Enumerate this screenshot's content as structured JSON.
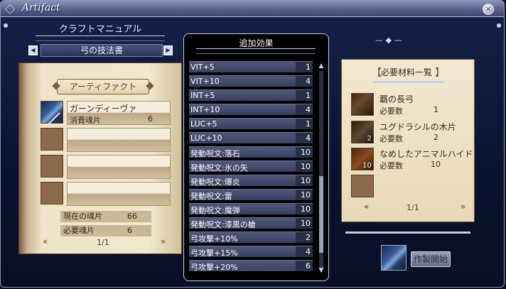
{
  "window": {
    "title": "Artifact",
    "close_symbol": "×"
  },
  "left": {
    "header": "クラフトマニュアル",
    "tab": {
      "label": "弓の技法書",
      "prev_symbol": "◀",
      "next_symbol": "▶"
    },
    "book_title": "アーティファクト",
    "entries": [
      {
        "name": "ガーンディーヴァ",
        "sub": "消費魂片",
        "value": "6"
      },
      {
        "name": "",
        "sub": "",
        "value": ""
      },
      {
        "name": "",
        "sub": "",
        "value": ""
      },
      {
        "name": "",
        "sub": "",
        "value": ""
      }
    ],
    "souls": {
      "current_label": "現在の魂片",
      "current_value": "66",
      "required_label": "必要魂片",
      "required_value": "6"
    },
    "pager": {
      "text": "1/1",
      "prev": "«",
      "next": "»"
    }
  },
  "middle": {
    "title": "追加効果",
    "effects": [
      {
        "name": "VIT+5",
        "value": "1"
      },
      {
        "name": "VIT+10",
        "value": "4"
      },
      {
        "name": "INT+5",
        "value": "1"
      },
      {
        "name": "INT+10",
        "value": "4"
      },
      {
        "name": "LUC+5",
        "value": "1"
      },
      {
        "name": "LUC+10",
        "value": "4"
      },
      {
        "name": "発動呪文:落石",
        "value": "10"
      },
      {
        "name": "発動呪文:氷の矢",
        "value": "10"
      },
      {
        "name": "発動呪文:爆炎",
        "value": "10"
      },
      {
        "name": "発動呪文:雷",
        "value": "10"
      },
      {
        "name": "発動呪文:魔弾",
        "value": "10"
      },
      {
        "name": "発動呪文:漆黒の槍",
        "value": "10"
      },
      {
        "name": "弓攻撃+10%",
        "value": "2"
      },
      {
        "name": "弓攻撃+15%",
        "value": "4"
      },
      {
        "name": "弓攻撃+20%",
        "value": "6"
      }
    ],
    "scroll": {
      "up": "▲",
      "down": "▼",
      "position": 0.55
    }
  },
  "right": {
    "title": "必要材料一覧",
    "materials": [
      {
        "name": "覇の長弓",
        "need_label": "必要数",
        "need": "1",
        "owned": ""
      },
      {
        "name": "ユグドラシルの木片",
        "need_label": "必要数",
        "need": "2",
        "owned": "2"
      },
      {
        "name": "なめしたアニマルハイド",
        "need_label": "必要数",
        "need": "10",
        "owned": "10"
      }
    ],
    "pager": {
      "text": "1/1",
      "prev": "«",
      "next": "»"
    },
    "craft_button": "作製開始"
  }
}
